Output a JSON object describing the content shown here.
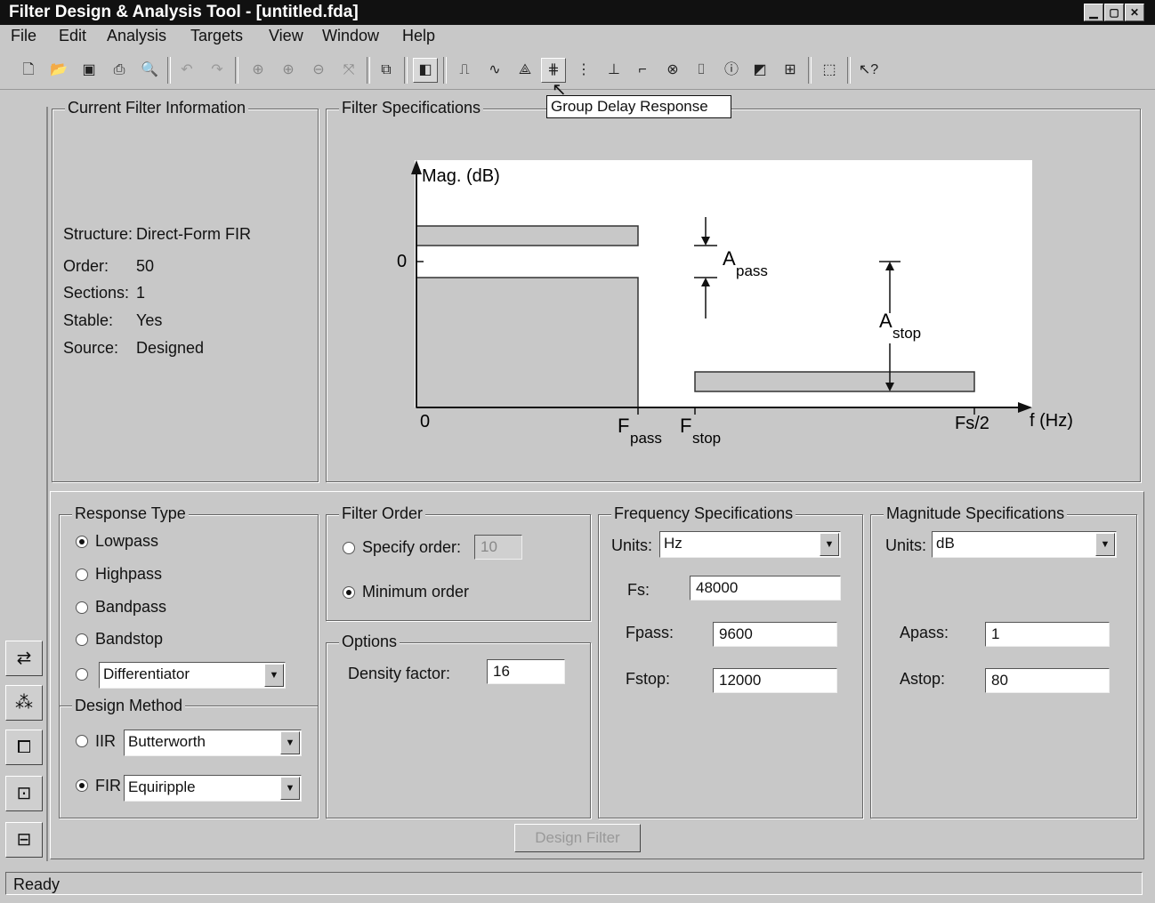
{
  "window": {
    "title": "Filter Design & Analysis Tool - [untitled.fda]"
  },
  "menu": [
    "File",
    "Edit",
    "Analysis",
    "Targets",
    "View",
    "Window",
    "Help"
  ],
  "tooltip": "Group Delay Response",
  "info": {
    "legend": "Current Filter Information",
    "rows": [
      {
        "k": "Structure:",
        "v": "Direct-Form FIR"
      },
      {
        "k": "Order:",
        "v": "50"
      },
      {
        "k": "Sections:",
        "v": "1"
      },
      {
        "k": "Stable:",
        "v": "Yes"
      },
      {
        "k": "Source:",
        "v": "Designed"
      }
    ]
  },
  "spec": {
    "legend": "Filter Specifications",
    "ylabel": "Mag. (dB)",
    "y0": "0",
    "x0": "0",
    "fpass": "F",
    "fpass_sub": "pass",
    "fstop": "F",
    "fstop_sub": "stop",
    "fs2": "Fs/2",
    "xlabel": "f (Hz)",
    "apass": "A",
    "apass_sub": "pass",
    "astop": "A",
    "astop_sub": "stop"
  },
  "response": {
    "legend": "Response Type",
    "options": [
      "Lowpass",
      "Highpass",
      "Bandpass",
      "Bandstop"
    ],
    "selected": "Lowpass",
    "other": "Differentiator"
  },
  "design": {
    "legend": "Design Method",
    "iir_label": "IIR",
    "iir_value": "Butterworth",
    "fir_label": "FIR",
    "fir_value": "Equiripple",
    "selected": "FIR"
  },
  "order": {
    "legend": "Filter Order",
    "specify": "Specify order:",
    "specify_value": "10",
    "minimum": "Minimum order",
    "selected": "Minimum order"
  },
  "options": {
    "legend": "Options",
    "density_label": "Density factor:",
    "density_value": "16"
  },
  "freq": {
    "legend": "Frequency Specifications",
    "units_label": "Units:",
    "units": "Hz",
    "fs_label": "Fs:",
    "fs": "48000",
    "fpass_label": "Fpass:",
    "fpass": "9600",
    "fstop_label": "Fstop:",
    "fstop": "12000"
  },
  "mag": {
    "legend": "Magnitude Specifications",
    "units_label": "Units:",
    "units": "dB",
    "apass_label": "Apass:",
    "apass": "1",
    "astop_label": "Astop:",
    "astop": "80"
  },
  "design_button": "Design Filter",
  "status": "Ready"
}
